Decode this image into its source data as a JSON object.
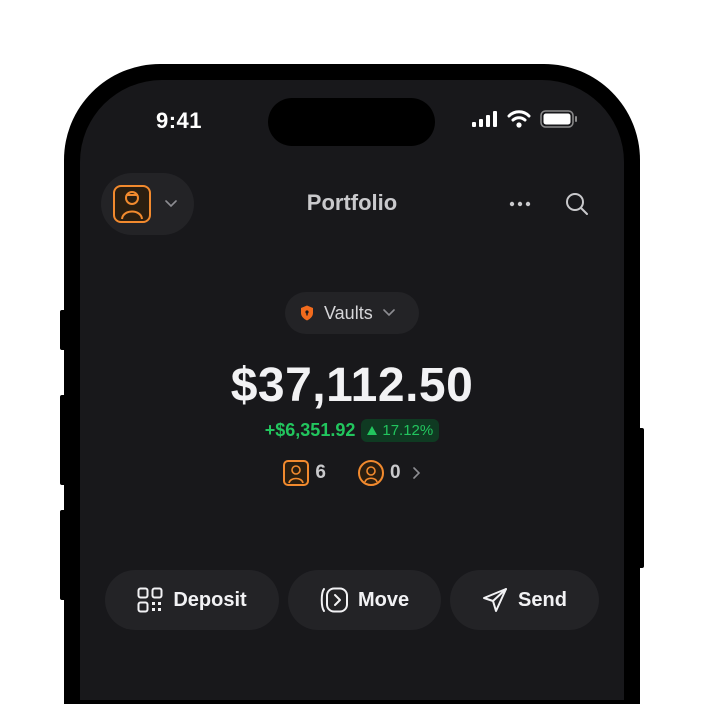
{
  "status_bar": {
    "time": "9:41"
  },
  "header": {
    "title": "Portfolio"
  },
  "vault_selector": {
    "label": "Vaults"
  },
  "balance": {
    "total": "$37,112.50",
    "change_amount": "+$6,351.92",
    "change_percent": "17.12%"
  },
  "counts": {
    "nfts": "6",
    "collectibles": "0"
  },
  "actions": {
    "deposit": "Deposit",
    "move": "Move",
    "send": "Send"
  },
  "colors": {
    "accent": "#f28a2e",
    "positive": "#22c55e",
    "background": "#18181b",
    "surface": "#232326"
  },
  "icons": [
    "avatar",
    "chevron-down-icon",
    "more-icon",
    "search-icon",
    "shield-icon",
    "triangle-up-icon",
    "qr-icon",
    "move-icon",
    "send-icon",
    "chevron-right-icon"
  ]
}
